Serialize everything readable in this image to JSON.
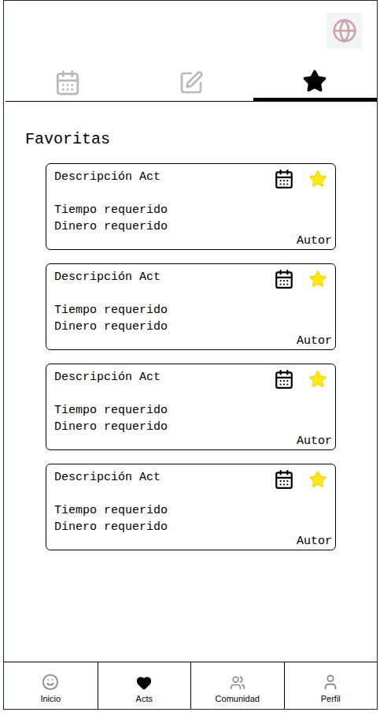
{
  "tabs": [
    {
      "icon": "calendar",
      "selected": false
    },
    {
      "icon": "edit",
      "selected": false
    },
    {
      "icon": "star",
      "selected": true
    }
  ],
  "section": {
    "title": "Favoritas"
  },
  "cards": [
    {
      "description": "Descripción Act",
      "time": "Tiempo requerido",
      "money": "Dinero requerido",
      "author": "Autor",
      "favorite": true
    },
    {
      "description": "Descripción Act",
      "time": "Tiempo requerido",
      "money": "Dinero requerido",
      "author": "Autor",
      "favorite": true
    },
    {
      "description": "Descripción Act",
      "time": "Tiempo requerido",
      "money": "Dinero requerido",
      "author": "Autor",
      "favorite": true
    },
    {
      "description": "Descripción Act",
      "time": "Tiempo requerido",
      "money": "Dinero requerido",
      "author": "Autor",
      "favorite": true
    }
  ],
  "nav": [
    {
      "label": "Inicio",
      "icon": "smile",
      "selected": false
    },
    {
      "label": "Acts",
      "icon": "heart",
      "selected": true
    },
    {
      "label": "Comunidad",
      "icon": "users",
      "selected": false
    },
    {
      "label": "Perfil",
      "icon": "user",
      "selected": false
    }
  ]
}
